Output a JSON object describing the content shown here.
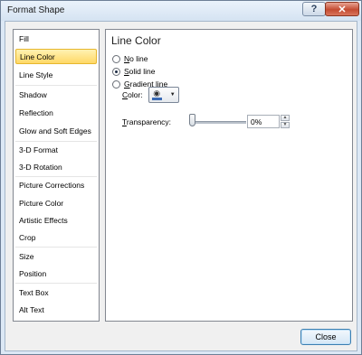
{
  "window": {
    "title": "Format Shape",
    "help_label": "?",
    "close_label": "✕"
  },
  "nav": {
    "items": [
      {
        "label": "Fill"
      },
      {
        "label": "Line Color"
      },
      {
        "label": "Line Style"
      },
      {
        "label": "Shadow"
      },
      {
        "label": "Reflection"
      },
      {
        "label": "Glow and Soft Edges"
      },
      {
        "label": "3-D Format"
      },
      {
        "label": "3-D Rotation"
      },
      {
        "label": "Picture Corrections"
      },
      {
        "label": "Picture Color"
      },
      {
        "label": "Artistic Effects"
      },
      {
        "label": "Crop"
      },
      {
        "label": "Size"
      },
      {
        "label": "Position"
      },
      {
        "label": "Text Box"
      },
      {
        "label": "Alt Text"
      }
    ],
    "selected_index": 1
  },
  "panel": {
    "title": "Line Color",
    "options": [
      {
        "label_hot": "N",
        "label_rest": "o line",
        "checked": false
      },
      {
        "label_hot": "S",
        "label_rest": "olid line",
        "checked": true
      },
      {
        "label_hot": "G",
        "label_rest": "radient line",
        "checked": false
      }
    ],
    "color": {
      "label_hot": "C",
      "label_rest": "olor:",
      "swatch_color": "#3b6bb5",
      "icon": "paint-bucket-icon"
    },
    "transparency": {
      "label_hot": "T",
      "label_rest": "ransparency:",
      "value": "0%",
      "level": 0
    }
  },
  "footer": {
    "close_label": "Close"
  }
}
